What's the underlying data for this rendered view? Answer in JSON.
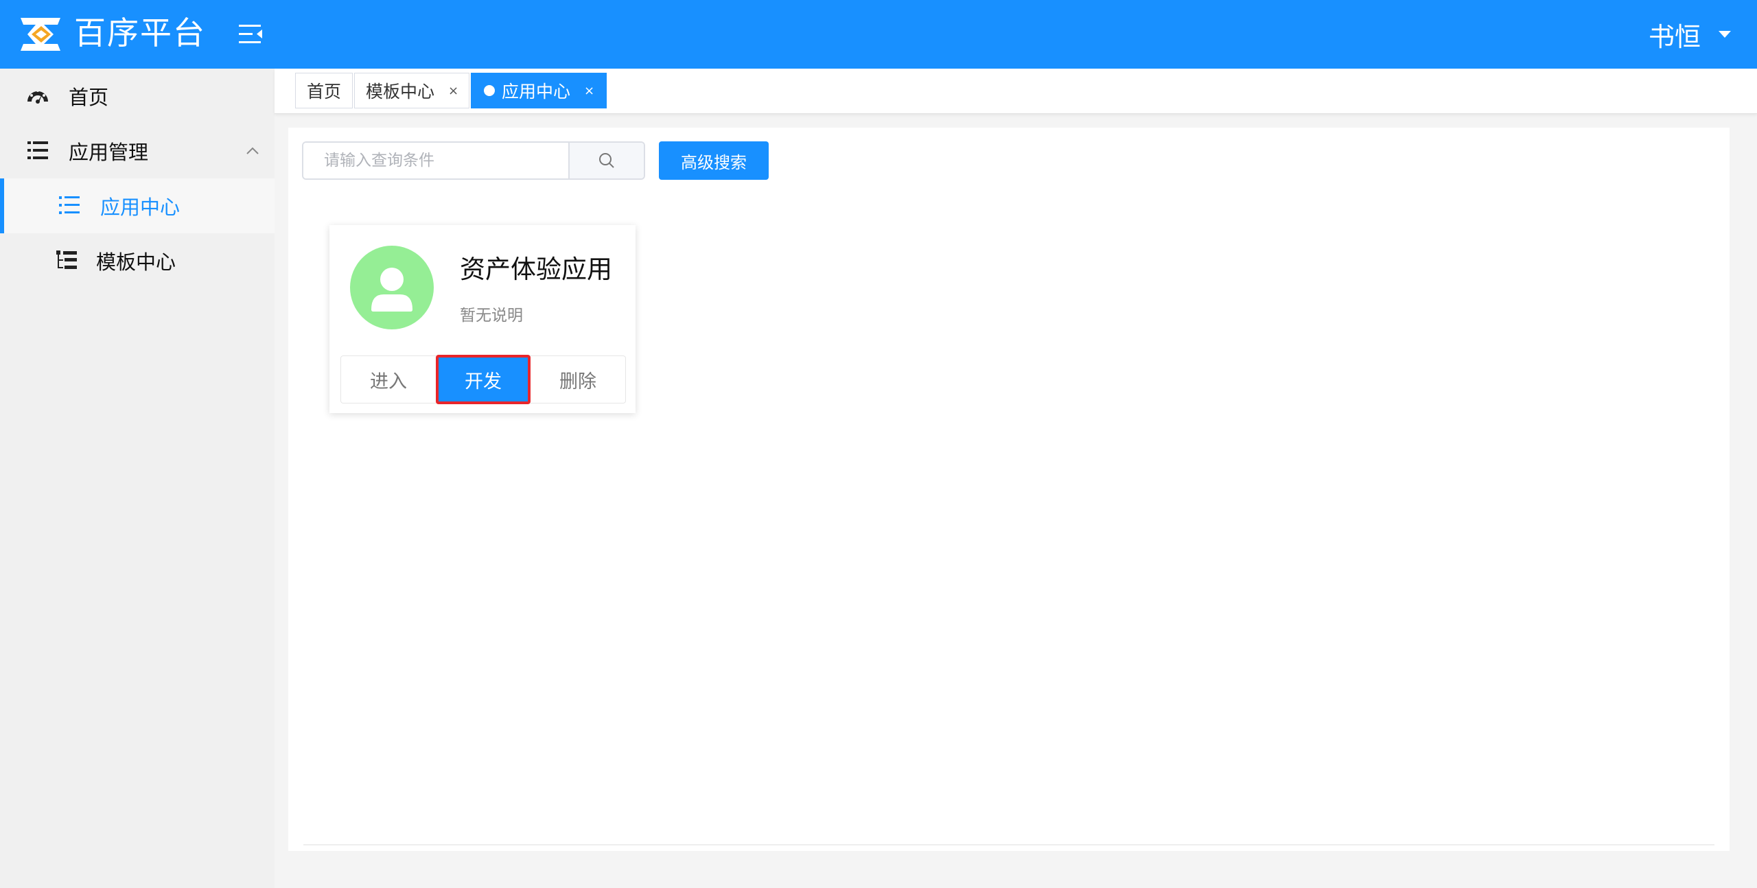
{
  "header": {
    "app_title": "百序平台",
    "user_name": "书恒",
    "brand_color": "#1890ff"
  },
  "sidebar": {
    "items": [
      {
        "label": "首页",
        "icon": "dashboard-icon"
      },
      {
        "label": "应用管理",
        "icon": "list-icon",
        "expanded": true
      },
      {
        "label": "应用中心",
        "icon": "list-icon",
        "active": true
      },
      {
        "label": "模板中心",
        "icon": "tree-table-icon"
      }
    ]
  },
  "tabs": [
    {
      "label": "首页"
    },
    {
      "label": "模板中心",
      "close": "×"
    },
    {
      "label": "应用中心",
      "close": "×",
      "active": true
    }
  ],
  "search": {
    "placeholder": "请输入查询条件",
    "value": "",
    "advanced_label": "高级搜索"
  },
  "apps": [
    {
      "name": "资产体验应用",
      "description": "暂无说明",
      "actions": {
        "enter": "进入",
        "develop": "开发",
        "delete": "删除"
      }
    }
  ]
}
